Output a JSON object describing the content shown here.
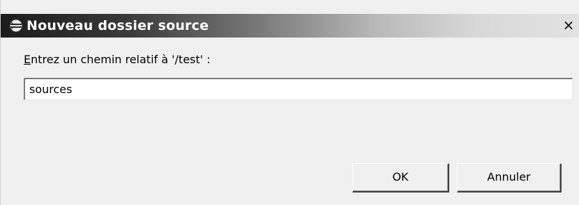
{
  "window": {
    "title": "Nouveau dossier source",
    "close_label": "×",
    "icon": "eclipse-folder-icon"
  },
  "form": {
    "prompt_mnemonic": "E",
    "prompt_rest": "ntrez un chemin relatif à '/test' :",
    "path_value": "sources"
  },
  "buttons": {
    "ok_label": "OK",
    "cancel_label": "Annuler"
  }
}
